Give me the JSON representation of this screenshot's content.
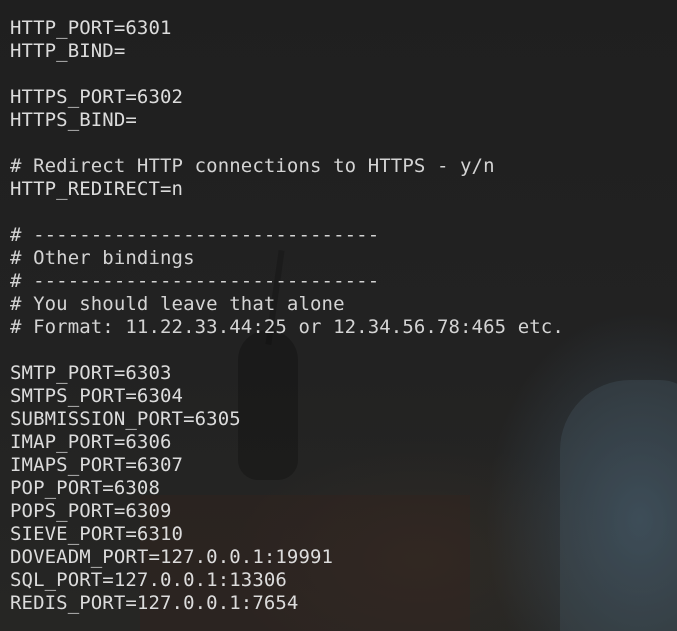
{
  "terminal": {
    "lines": [
      {
        "text": "HTTP_PORT=6301"
      },
      {
        "text": "HTTP_BIND="
      },
      {
        "text": ""
      },
      {
        "text": "HTTPS_PORT=6302"
      },
      {
        "text": "HTTPS_BIND="
      },
      {
        "text": ""
      },
      {
        "text": "# Redirect HTTP connections to HTTPS - y/n"
      },
      {
        "text": "HTTP_REDIRECT=n"
      },
      {
        "text": ""
      },
      {
        "text": "# ------------------------------"
      },
      {
        "text": "# Other bindings"
      },
      {
        "text": "# ------------------------------"
      },
      {
        "text": "# You should leave that alone"
      },
      {
        "text": "# Format: 11.22.33.44:25 or 12.34.56.78:465 etc."
      },
      {
        "text": ""
      },
      {
        "text": "SMTP_PORT=6303"
      },
      {
        "text": "SMTPS_PORT=6304"
      },
      {
        "text": "SUBMISSION_PORT=6305"
      },
      {
        "text": "IMAP_PORT=6306"
      },
      {
        "text": "IMAPS_PORT=6307"
      },
      {
        "text": "POP_PORT=6308"
      },
      {
        "text": "POPS_PORT=6309"
      },
      {
        "text": "SIEVE_PORT=6310"
      },
      {
        "text": "DOVEADM_PORT=127.0.0.1:19991"
      },
      {
        "text": "SQL_PORT=127.0.0.1:13306"
      },
      {
        "text": "REDIS_PORT=127.0.0.1:7654"
      }
    ]
  },
  "colors": {
    "background": "#202020",
    "text": "#dcdcdc"
  }
}
